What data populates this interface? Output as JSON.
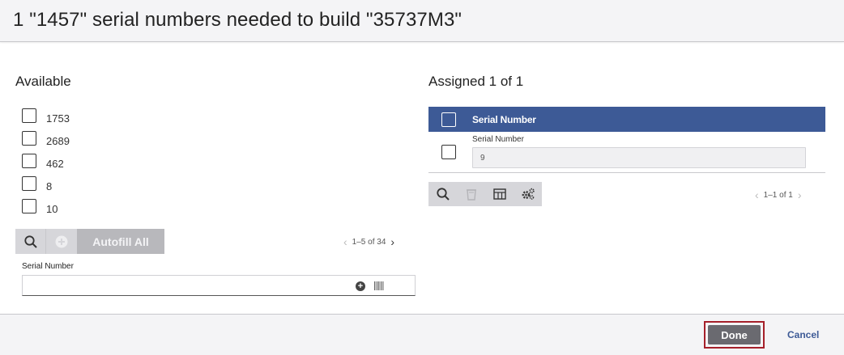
{
  "dialog": {
    "title": "1 \"1457\" serial numbers needed to build \"35737M3\""
  },
  "available": {
    "title": "Available",
    "items": [
      {
        "label": "1753",
        "checked": false
      },
      {
        "label": "2689",
        "checked": false
      },
      {
        "label": "462",
        "checked": false
      },
      {
        "label": "8",
        "checked": false
      },
      {
        "label": "10",
        "checked": false
      }
    ],
    "toolbar": {
      "search_icon": "search-icon",
      "add_icon": "add-circle-icon",
      "autofill_label": "Autofill All"
    },
    "pager": {
      "text": "1–5 of 34"
    },
    "serial_input": {
      "label": "Serial Number",
      "value": "",
      "placeholder": ""
    }
  },
  "assigned": {
    "title": "Assigned 1 of 1",
    "table": {
      "header": "Serial Number",
      "rows": [
        {
          "field_label": "Serial Number",
          "value": "9",
          "checked": false
        }
      ]
    },
    "toolbar": {
      "icons": [
        "search-icon",
        "delete-icon",
        "table-columns-icon",
        "settings-gears-icon"
      ]
    },
    "pager": {
      "text": "1–1 of 1"
    }
  },
  "footer": {
    "done_label": "Done",
    "cancel_label": "Cancel"
  },
  "colors": {
    "accent": "#3d5a96",
    "highlight_outline": "#a5202a",
    "done_button": "#6a6a70"
  }
}
